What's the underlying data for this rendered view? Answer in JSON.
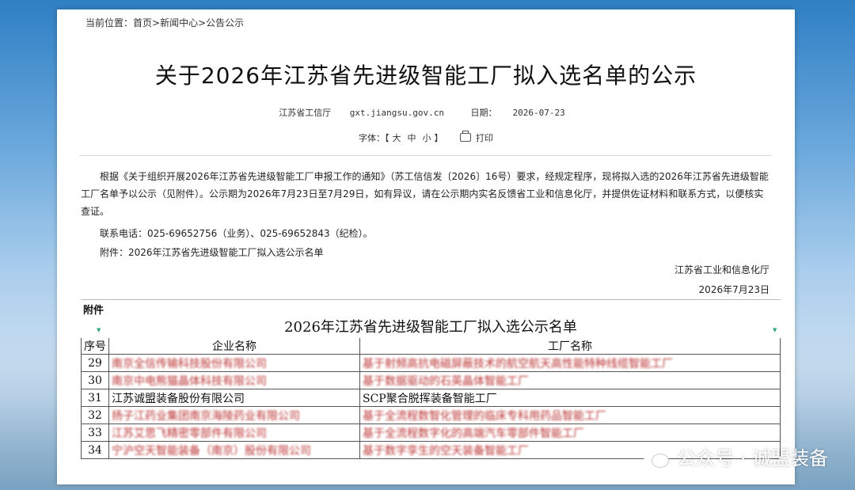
{
  "breadcrumb": {
    "label": "当前位置：",
    "home": "首页",
    "news": "新闻中心",
    "current": "公告公示",
    "separator": ">"
  },
  "article": {
    "title": "关于2026年江苏省先进级智能工厂拟入选名单的公示",
    "source": "江苏省工信厅",
    "site": "gxt.jiangsu.gov.cn",
    "date_label": "日期：",
    "date": "2026-07-23",
    "font_label": "字体：【",
    "font_large": "大",
    "font_medium": "中",
    "font_small": "小",
    "font_close": "】",
    "print_label": "打印",
    "paragraph1": "根据《关于组织开展2026年江苏省先进级智能工厂申报工作的通知》（苏工信信发〔2026〕16号）要求，经规定程序，现将拟入选的2026年江苏省先进级智能工厂名单予以公示（见附件）。公示期为2026年7月23日至7月29日，如有异议，请在公示期内实名反馈省工业和信息化厅，并提供佐证材料和联系方式，以便核实查证。",
    "paragraph2": "联系电话：025-69652756（业务）、025-69652843（纪检）。",
    "paragraph3": "附件：2026年江苏省先进级智能工厂拟入选公示名单",
    "signature": "江苏省工业和信息化厅",
    "sign_date": "2026年7月23日"
  },
  "attachment": {
    "label": "附件",
    "title": "2026年江苏省先进级智能工厂拟入选公示名单",
    "headers": {
      "no": "序号",
      "company": "企业名称",
      "factory": "工厂名称"
    },
    "rows": [
      {
        "no": "29",
        "company": "南京全信传输科技股份有限公司",
        "factory": "基于射频高抗电磁屏蔽技术的航空航天高性能特种线缆智能工厂"
      },
      {
        "no": "30",
        "company": "南京中电熊猫晶体科技有限公司",
        "factory": "基于数据驱动的石英晶体智能工厂"
      },
      {
        "no": "31",
        "company": "江苏诚盟装备股份有限公司",
        "factory": "SCP聚合脱挥装备智能工厂"
      },
      {
        "no": "32",
        "company": "扬子江药业集团南京海陵药业有限公司",
        "factory": "基于全流程数智化管理的临床专科用药品智能工厂"
      },
      {
        "no": "33",
        "company": "江苏艾思飞精密零部件有限公司",
        "factory": "基于全流程数字化的高端汽车零部件智能工厂"
      },
      {
        "no": "34",
        "company": "宁沪空天智能装备（南京）股份有限公司",
        "factory": "基于数字孪生的空天装备智能工厂"
      }
    ]
  },
  "watermark": "公众号 · 诚盟装备",
  "icons": {
    "print": "printer-icon",
    "wechat": "wechat-icon",
    "dropdown": "dropdown-arrow-icon"
  }
}
